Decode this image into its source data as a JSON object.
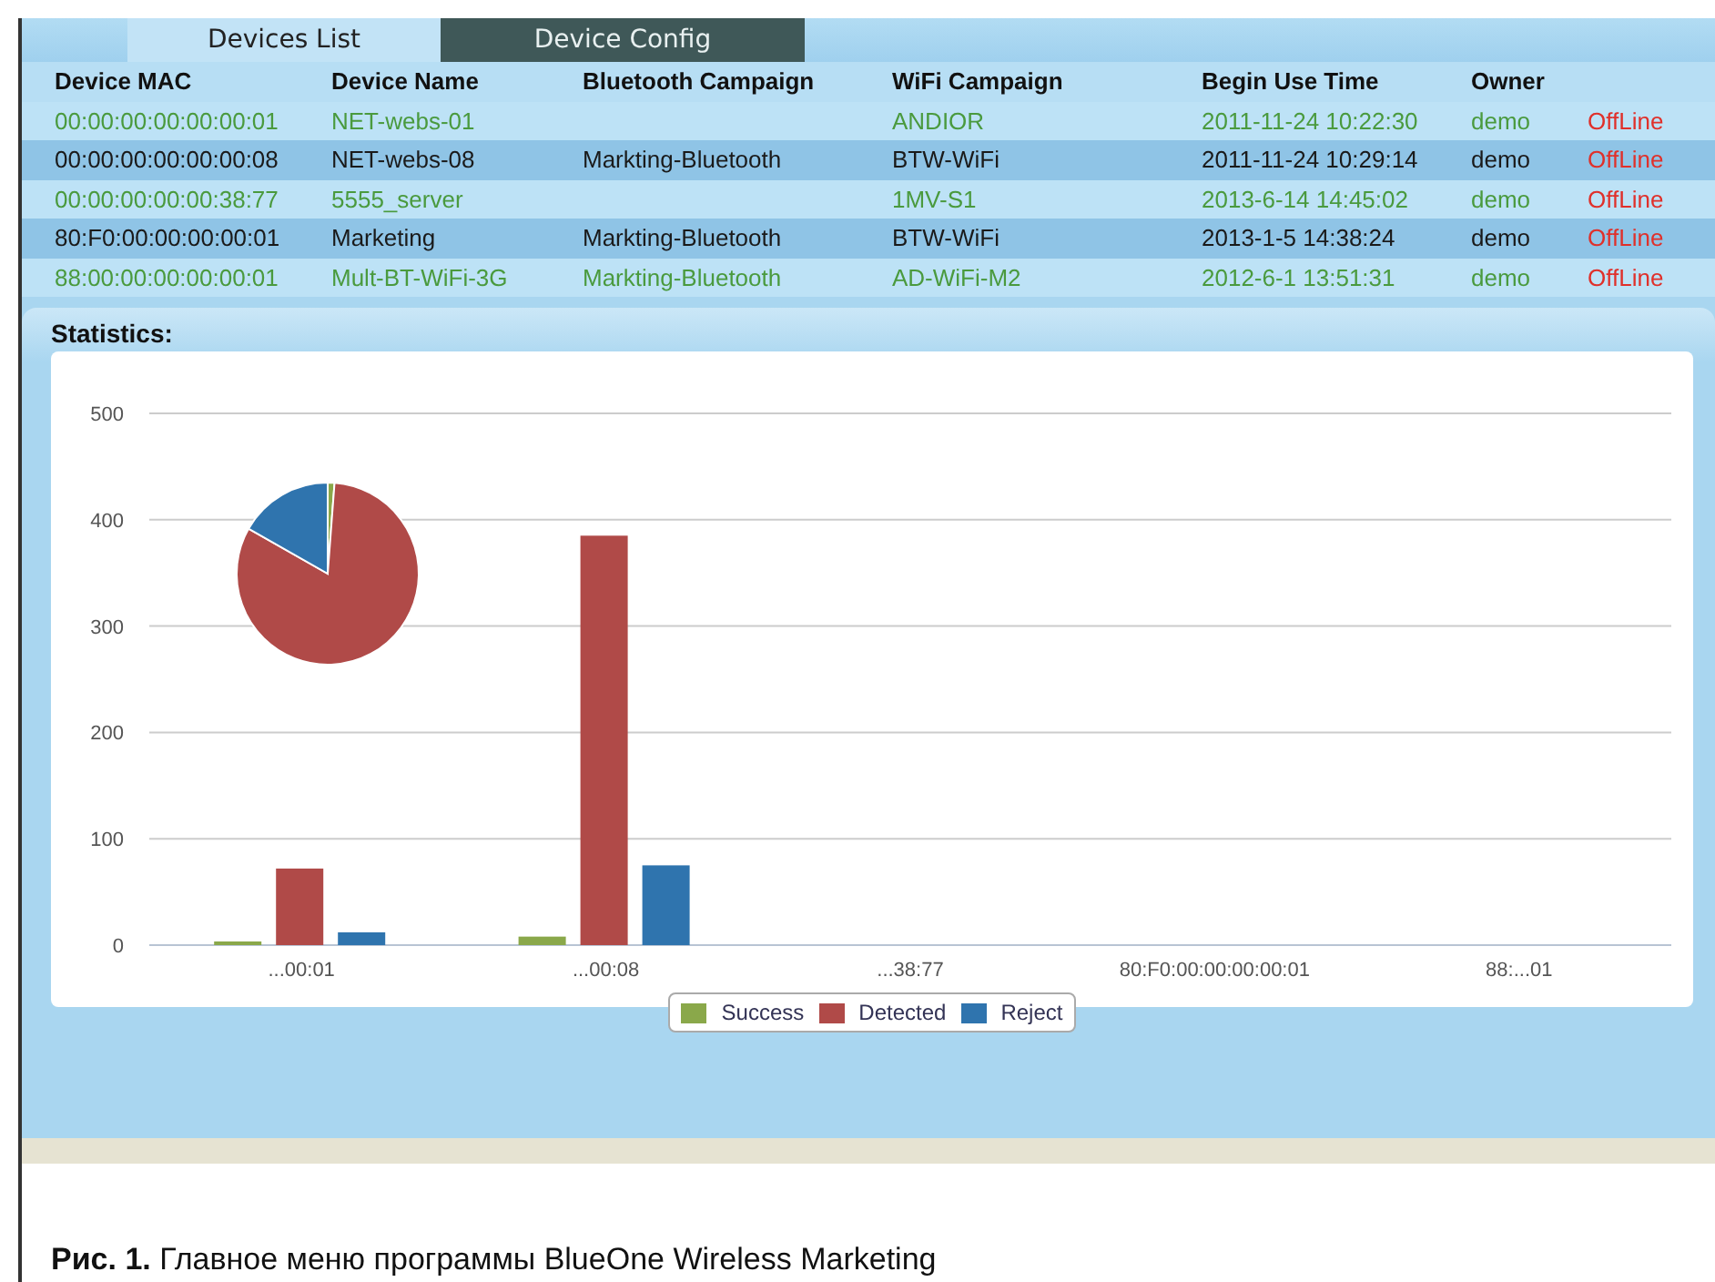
{
  "tabs": [
    {
      "label": "Devices List",
      "selected": true
    },
    {
      "label": "Device Config",
      "selected": false
    }
  ],
  "table": {
    "columns": [
      "Device MAC",
      "Device Name",
      "Bluetooth Campaign",
      "WiFi Campaign",
      "Begin Use Time",
      "Owner"
    ],
    "rows": [
      {
        "mac": "00:00:00:00:00:00:01",
        "name": "NET-webs-01",
        "wifi": "ANDIOR",
        "begin": "2011-11-24 10:22:30",
        "owner": "demo",
        "status": "OffLine"
      },
      {
        "mac": "00:00:00:00:00:00:08",
        "name": "NET-webs-08",
        "bluetooth": "Markting-Bluetooth",
        "wifi": "BTW-WiFi",
        "begin": "2011-11-24 10:29:14",
        "owner": "demo",
        "status": "OffLine"
      },
      {
        "mac": "00:00:00:00:00:38:77",
        "name": "5555_server",
        "wifi": "1MV-S1",
        "begin": "2013-6-14 14:45:02",
        "owner": "demo",
        "status": "OffLine"
      },
      {
        "mac": "80:F0:00:00:00:00:01",
        "name": "Marketing",
        "bluetooth": "Markting-Bluetooth",
        "wifi": "BTW-WiFi",
        "begin": "2013-1-5 14:38:24",
        "owner": "demo",
        "status": "OffLine"
      },
      {
        "mac": "88:00:00:00:00:00:01",
        "name": "Mult-BT-WiFi-3G",
        "bluetooth": "Markting-Bluetooth",
        "wifi": "AD-WiFi-M2",
        "begin": "2012-6-1 13:51:31",
        "owner": "demo",
        "status": "OffLine"
      }
    ]
  },
  "statistics": {
    "title": "Statistics:",
    "chart_data": {
      "type": "bar",
      "categories": [
        "...00:01",
        "...00:08",
        "...38:77",
        "80:F0:00:00:00:00:01",
        "88:...01"
      ],
      "series": [
        {
          "name": "Success",
          "color": "#8aa84a",
          "values": [
            3,
            8,
            0,
            0,
            0
          ]
        },
        {
          "name": "Detected",
          "color": "#b04a48",
          "values": [
            72,
            385,
            0,
            0,
            0
          ]
        },
        {
          "name": "Reject",
          "color": "#2f74ae",
          "values": [
            12,
            75,
            0,
            0,
            0
          ]
        }
      ],
      "ylim": [
        0,
        500
      ],
      "grid": true,
      "yticks": [
        0,
        100,
        200,
        300,
        400,
        500
      ]
    }
  },
  "caption": "**Рис. 1.** Главное меню программы BlueOne Wireless Marketing"
}
